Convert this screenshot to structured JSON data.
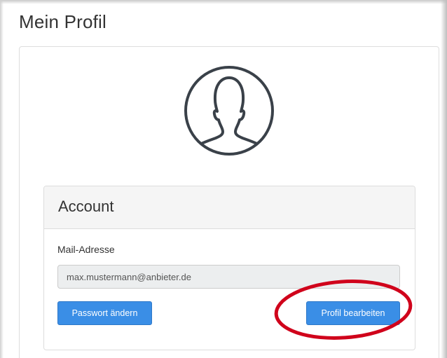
{
  "page": {
    "title": "Mein Profil"
  },
  "avatar": {
    "icon": "user-silhouette-icon"
  },
  "account_panel": {
    "title": "Account",
    "email_label": "Mail-Adresse",
    "email_value": "max.mustermann@anbieter.de",
    "change_password_label": "Passwort ändern",
    "edit_profile_label": "Profil bearbeiten"
  },
  "annotation": {
    "type": "red-ellipse-highlight",
    "color": "#d0021b"
  },
  "colors": {
    "primary_button": "#3a8ee6",
    "panel_heading_bg": "#f5f5f5",
    "input_bg": "#eceeef"
  }
}
